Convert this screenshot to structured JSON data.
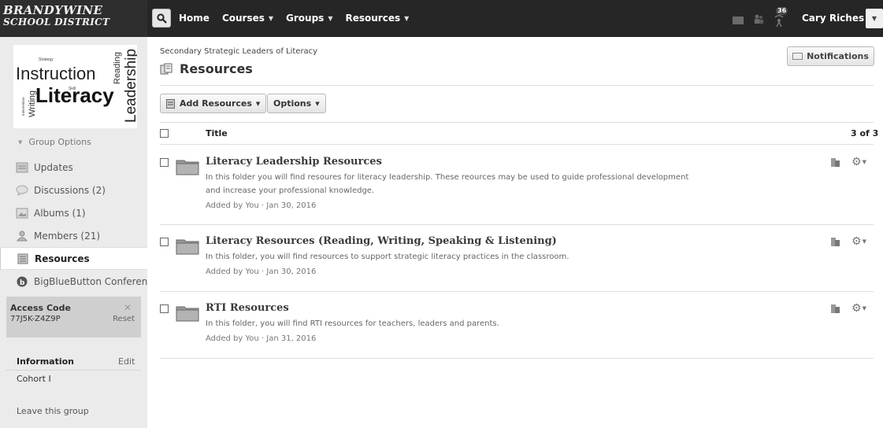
{
  "logo": {
    "line1": "BRANDYWINE",
    "line2": "SCHOOL DISTRICT"
  },
  "topnav": {
    "items": [
      {
        "label": "Home"
      },
      {
        "label": "Courses"
      },
      {
        "label": "Groups"
      },
      {
        "label": "Resources"
      }
    ],
    "notification_count": "36",
    "user_name": "Cary Riches"
  },
  "sidebar": {
    "group_image_words": {
      "instruction": "Instruction",
      "literacy": "Literacy",
      "leadership": "Leadership",
      "reading": "Reading",
      "writing": "Writing",
      "strategy": "Strategy",
      "intervention": "Intervention",
      "skill": "Skill"
    },
    "group_options": "Group Options",
    "items": [
      {
        "label": "Updates",
        "icon": "updates-icon"
      },
      {
        "label": "Discussions (2)",
        "icon": "discussions-icon"
      },
      {
        "label": "Albums (1)",
        "icon": "albums-icon"
      },
      {
        "label": "Members (21)",
        "icon": "members-icon"
      },
      {
        "label": "Resources",
        "icon": "resources-icon"
      },
      {
        "label": "BigBlueButton Conferen...",
        "icon": "bigbluebutton-icon"
      }
    ],
    "access_code": {
      "title": "Access Code",
      "code": "77J5K-Z4Z9P",
      "reset": "Reset"
    },
    "information": {
      "title": "Information",
      "edit": "Edit",
      "value": "Cohort I"
    },
    "leave": "Leave this group"
  },
  "main": {
    "breadcrumb": "Secondary Strategic Leaders of Literacy",
    "title": "Resources",
    "notifications_label": "Notifications",
    "add_resources_label": "Add Resources",
    "options_label": "Options",
    "column_title": "Title",
    "count": "3 of 3",
    "rows": [
      {
        "title": "Literacy Leadership Resources",
        "desc": "In this folder you will find resoures for literacy leadership.  These reources may be used to guide professional development and increase your professional knowledge.",
        "meta": "Added by You · Jan 30, 2016"
      },
      {
        "title": "Literacy Resources (Reading, Writing, Speaking & Listening)",
        "desc": "In this folder, you will find resources to support strategic literacy practices in the classroom.",
        "meta": "Added by You · Jan 30, 2016"
      },
      {
        "title": "RTI Resources",
        "desc": "In this folder, you will find RTI resources for teachers, leaders and parents.",
        "meta": "Added by You · Jan 31, 2016"
      }
    ]
  },
  "colors": {
    "topbar": "#262626",
    "sidebar": "#ebebeb",
    "access_box": "#cfcfcf"
  }
}
